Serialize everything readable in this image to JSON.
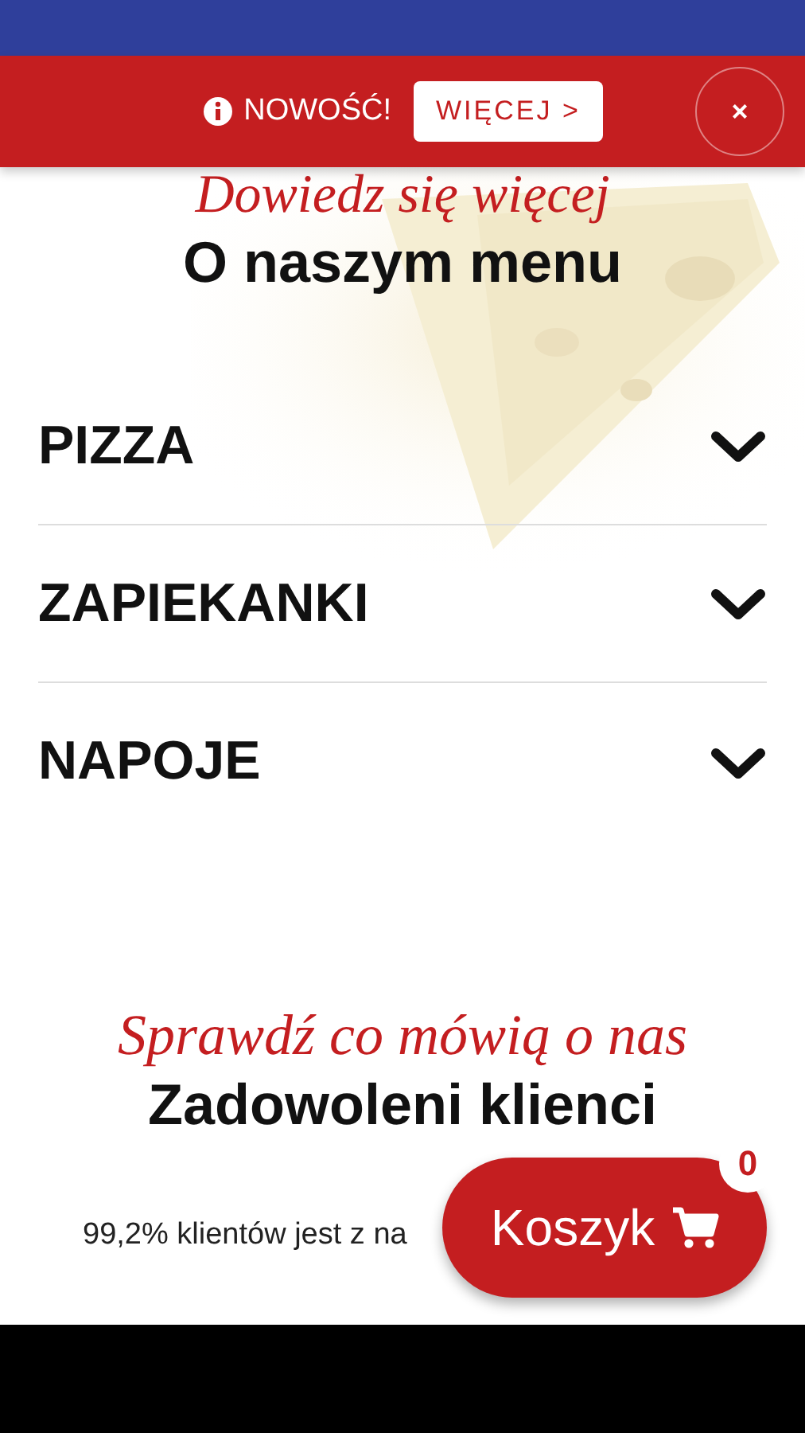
{
  "banner": {
    "label": "NOWOŚĆ!",
    "button": "WIĘCEJ >",
    "close": "×"
  },
  "menu_section": {
    "subtitle": "Dowiedz się więcej",
    "title": "O naszym menu",
    "categories": [
      {
        "label": "PIZZA",
        "expanded": false
      },
      {
        "label": "ZAPIEKANKI",
        "expanded": false
      },
      {
        "label": "NAPOJE",
        "expanded": false
      }
    ]
  },
  "reviews_section": {
    "subtitle": "Sprawdź co mówią o nas",
    "title": "Zadowoleni klienci",
    "text": "99,2% klientów jest z na"
  },
  "cart": {
    "label": "Koszyk",
    "count": "0"
  }
}
